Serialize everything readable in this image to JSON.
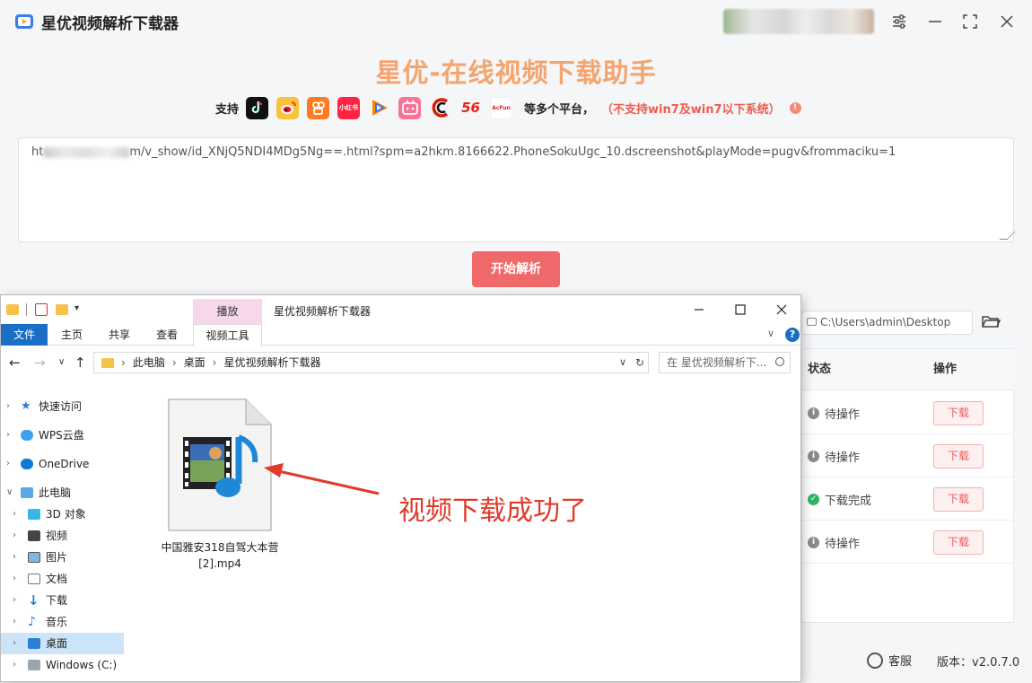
{
  "app": {
    "name": "星优视频解析下载器",
    "banner_title": "星优-在线视频下载助手",
    "window_controls": [
      "settings-icon",
      "minimize-icon",
      "maximize-icon",
      "close-icon"
    ]
  },
  "platforms": {
    "support_label": "支持",
    "logos": [
      "tiktok-icon",
      "weibo-icon",
      "kuaishou-icon",
      "xiaohongshu-icon",
      "tencent-video-icon",
      "bilibili-icon",
      "cctv-icon",
      "56-icon",
      "acfun-icon"
    ],
    "pf_56_text": "56",
    "pf_xhs_text": "小红书",
    "pf_acfun_text": "AcFun",
    "more_label": "等多个平台，",
    "warning": "（不支持win7及win7以下系统）"
  },
  "url_input": {
    "prefix": "ht",
    "suffix": "m/v_show/id_XNjQ5NDI4MDg5Ng==.html?spm=a2hkm.8166622.PhoneSokuUgc_10.dscreenshot&playMode=pugv&frommaciku=1"
  },
  "parse_button": "开始解析",
  "save_path": "C:\\Users\\admin\\Desktop",
  "task_table": {
    "headers": {
      "status": "状态",
      "action": "操作"
    },
    "rows": [
      {
        "status": "待操作",
        "status_kind": "info",
        "action": "下载"
      },
      {
        "status": "待操作",
        "status_kind": "info",
        "action": "下载"
      },
      {
        "status": "下载完成",
        "status_kind": "success",
        "action": "下载"
      },
      {
        "status": "待操作",
        "status_kind": "info",
        "action": "下载"
      }
    ]
  },
  "footer": {
    "service": "客服",
    "version": "版本：v2.0.7.0"
  },
  "explorer": {
    "title": "星优视频解析下载器",
    "context_tab_group": "播放",
    "tabs": [
      "文件",
      "主页",
      "共享",
      "查看",
      "视频工具"
    ],
    "breadcrumb": [
      "此电脑",
      "桌面",
      "星优视频解析下载器"
    ],
    "search_placeholder": "在 星优视频解析下...",
    "nav": [
      {
        "label": "快速访问"
      },
      {
        "label": "WPS云盘"
      },
      {
        "label": "OneDrive"
      },
      {
        "label": "此电脑"
      },
      {
        "label": "3D 对象"
      },
      {
        "label": "视频"
      },
      {
        "label": "图片"
      },
      {
        "label": "文档"
      },
      {
        "label": "下载"
      },
      {
        "label": "音乐"
      },
      {
        "label": "桌面"
      },
      {
        "label": "Windows (C:)"
      }
    ],
    "file": {
      "name_line1": "中国雅安318自驾大本营",
      "name_line2": "[2].mp4"
    }
  },
  "annotation": "视频下载成功了",
  "colors": {
    "accent": "#f0696a",
    "banner": "#f4a46e",
    "warning": "#f05a4a",
    "explorer_blue": "#1a6fc4",
    "success": "#2fb36b"
  }
}
